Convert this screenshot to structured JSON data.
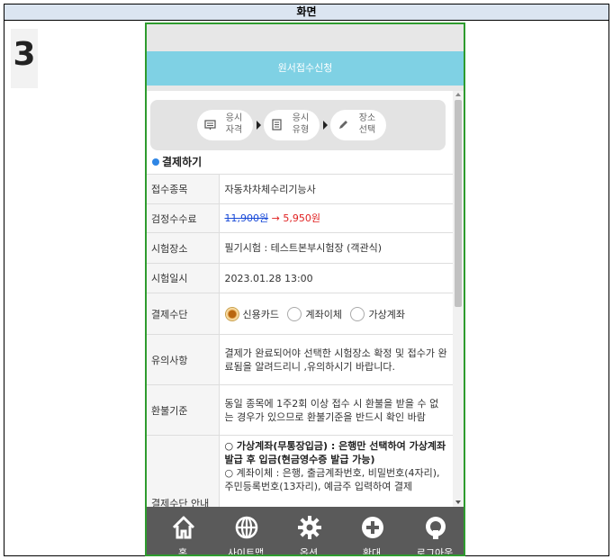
{
  "doc": {
    "header": "화면",
    "step_number": "3"
  },
  "app": {
    "title": "원서접수신청",
    "steps": [
      {
        "label": "응시\n자격",
        "icon": "id-card-icon"
      },
      {
        "label": "응시\n유형",
        "icon": "document-icon"
      },
      {
        "label": "장소\n선택",
        "icon": "pencil-icon"
      }
    ],
    "section_title": "결제하기",
    "rows": {
      "type": {
        "label": "접수종목",
        "value": "자동차차체수리기능사"
      },
      "fee": {
        "label": "검정수수료",
        "old": "11,900원",
        "arrow": "→",
        "new": "5,950원"
      },
      "venue": {
        "label": "시험장소",
        "value": "필기시험 : 테스트본부시험장 (객관식)"
      },
      "datetime": {
        "label": "시험일시",
        "value": "2023.01.28 13:00"
      },
      "payment": {
        "label": "결제수단",
        "options": [
          "신용카드",
          "계좌이체",
          "가상계좌"
        ],
        "selected": "신용카드"
      },
      "notice": {
        "label": "유의사항",
        "value": "결제가 완료되어야 선택한 시험장소 확정 및 접수가 완료됨을 알려드리니 ,유의하시기 바랍니다."
      },
      "refund": {
        "label": "환불기준",
        "value": "동일 종목에 1주2회 이상 접수 시 환불을 받을 수 없는 경우가 있으므로 환불기준을 반드시 확인 바람"
      },
      "guide": {
        "label": "결제수단 안내",
        "bold_text": "○ 가상계좌(무통장입금) : 은행만 선택하여 가상계좌 발급 후 입금(현금영수증 발급 가능)",
        "text": "○ 계좌이체 : 은행, 출금계좌번호, 비밀번호(4자리), 주민등록번호(13자리), 예금주 입력하여 결제"
      }
    },
    "tabbar": [
      {
        "label": "홈",
        "icon": "home-icon"
      },
      {
        "label": "사이트맵",
        "icon": "globe-icon"
      },
      {
        "label": "옵션",
        "icon": "gear-icon"
      },
      {
        "label": "확대",
        "icon": "plus-circle-icon"
      },
      {
        "label": "로그아웃",
        "icon": "logout-icon"
      }
    ]
  },
  "colors": {
    "header_bg": "#7fd1e4",
    "border_green": "#2e9b2e",
    "tabbar_bg": "#5a5a5a",
    "fee_old": "#1a4bd8",
    "fee_new": "#e02020",
    "accent_blue": "#2f86e5"
  }
}
